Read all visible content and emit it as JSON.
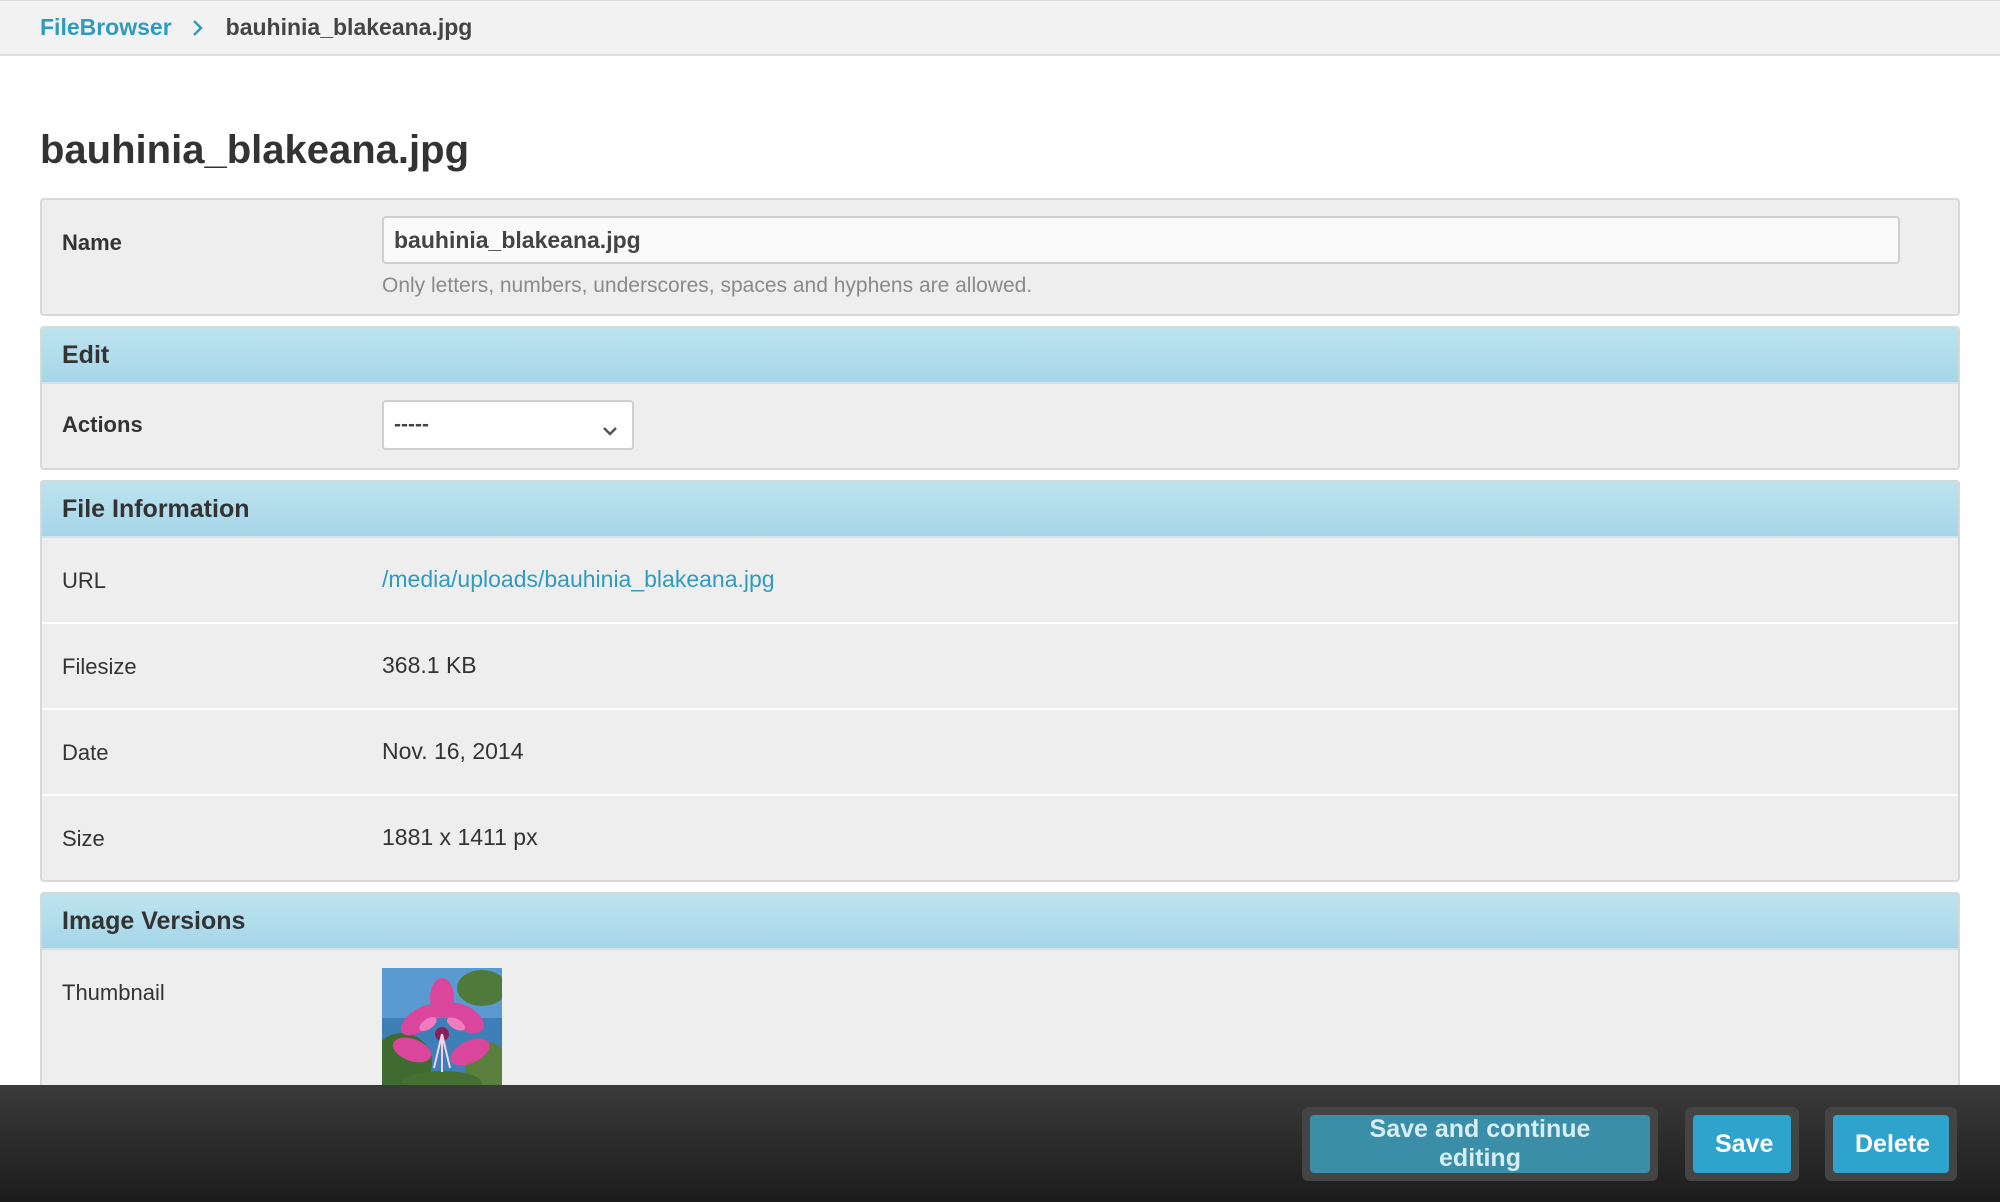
{
  "breadcrumb": {
    "root_label": "FileBrowser",
    "current": "bauhinia_blakeana.jpg"
  },
  "page_title": "bauhinia_blakeana.jpg",
  "name_section": {
    "label": "Name",
    "value": "bauhinia_blakeana.jpg",
    "help": "Only letters, numbers, underscores, spaces and hyphens are allowed."
  },
  "edit_section": {
    "header": "Edit",
    "actions_label": "Actions",
    "actions_selected": "-----"
  },
  "file_info": {
    "header": "File Information",
    "rows": [
      {
        "label": "URL",
        "value": "/media/uploads/bauhinia_blakeana.jpg"
      },
      {
        "label": "Filesize",
        "value": "368.1 KB"
      },
      {
        "label": "Date",
        "value": "Nov. 16, 2014"
      },
      {
        "label": "Size",
        "value": "1881 x 1411 px"
      }
    ]
  },
  "image_versions": {
    "header": "Image Versions",
    "thumbnail_label": "Thumbnail"
  },
  "buttons": {
    "save_continue": "Save and continue editing",
    "save": "Save",
    "delete": "Delete"
  },
  "colors": {
    "accent": "#309bbf",
    "header_bg": "#b3dded",
    "button_primary": "#2ea3cc"
  }
}
